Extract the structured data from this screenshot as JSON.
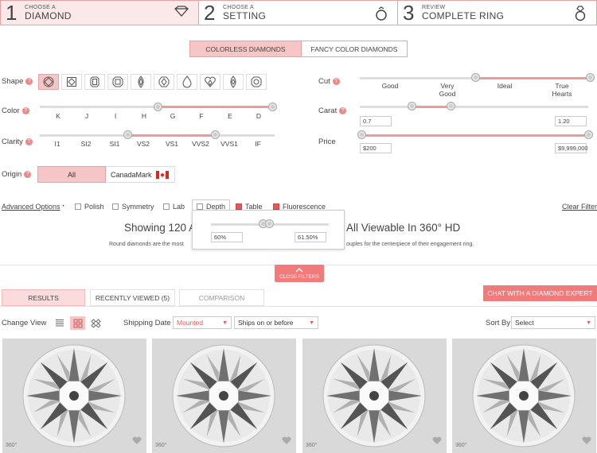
{
  "steps": [
    {
      "num": "1",
      "small": "CHOOSE A",
      "big": "DIAMOND",
      "icon": "diamond-icon"
    },
    {
      "num": "2",
      "small": "CHOOSE A",
      "big": "SETTING",
      "icon": "ring-icon"
    },
    {
      "num": "3",
      "small": "REVIEW",
      "big": "COMPLETE RING",
      "icon": "ring-with-diamond-icon"
    }
  ],
  "type_tabs": {
    "colorless": "COLORLESS DIAMONDS",
    "fancy": "FANCY COLOR DIAMONDS"
  },
  "filters": {
    "shape_label": "Shape",
    "color_label": "Color",
    "color_ticks": [
      "K",
      "J",
      "I",
      "H",
      "G",
      "F",
      "E",
      "D"
    ],
    "clarity_label": "Clarity",
    "clarity_ticks": [
      "I1",
      "SI2",
      "SI1",
      "VS2",
      "VS1",
      "VVS2",
      "VVS1",
      "IF"
    ],
    "origin_label": "Origin",
    "origin_all": "All",
    "origin_canadamark": "CanadaMark",
    "cut_label": "Cut",
    "cut_ticks": [
      "Good",
      "Very Good",
      "Ideal",
      "True Hearts"
    ],
    "carat_label": "Carat",
    "carat_min": "0.7",
    "carat_max": "1.20",
    "price_label": "Price",
    "price_min": "$200",
    "price_max": "$9,999,000"
  },
  "advanced": {
    "label": "Advanced Options",
    "marker": "•",
    "polish": "Polish",
    "symmetry": "Symmetry",
    "lab": "Lab",
    "depth": "Depth",
    "table": "Table",
    "fluorescence": "Fluorescence",
    "clear": "Clear Filter"
  },
  "depth_popup": {
    "min": "60%",
    "max": "61.50%"
  },
  "heading": {
    "left": "Showing 120 A",
    "right": "All Viewable In 360° HD"
  },
  "subtext": {
    "left": "Round diamonds are the most",
    "right": "ouples for the centerpiece of their engagement ring."
  },
  "close_filters": "CLOSE FILTERS",
  "results_tabs": {
    "results": "RESULTS",
    "recent": "RECENTLY VIEWED (5)",
    "comparison": "COMPARISON"
  },
  "chat": "CHAT WITH A DIAMOND EXPERT",
  "controls": {
    "change_view": "Change View",
    "shipping_date": "Shipping Date",
    "shipping_value": "Mounted",
    "ships_value": "Ships on or before",
    "sort_by": "Sort By",
    "sort_value": "Select"
  },
  "badge": "360°",
  "colors": {
    "accent": "#f17b7b",
    "light_pink": "#f6c6c6",
    "border_pink": "#e6a3a3"
  }
}
